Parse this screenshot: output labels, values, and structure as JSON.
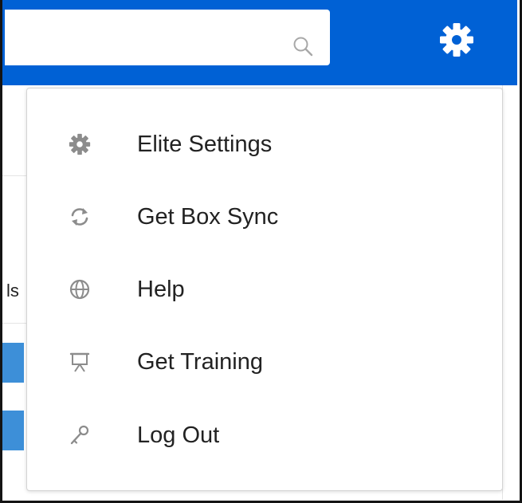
{
  "header": {
    "accent_color": "#0061d5",
    "search_icon": "search-icon",
    "settings_icon": "gear-icon"
  },
  "background": {
    "partial_text": "ls"
  },
  "menu": {
    "items": [
      {
        "label": "Elite Settings",
        "icon": "gear-icon"
      },
      {
        "label": "Get Box Sync",
        "icon": "sync-icon"
      },
      {
        "label": "Help",
        "icon": "help-lifebuoy-icon"
      },
      {
        "label": "Get Training",
        "icon": "training-presentation-icon"
      },
      {
        "label": "Log Out",
        "icon": "key-icon"
      }
    ]
  }
}
